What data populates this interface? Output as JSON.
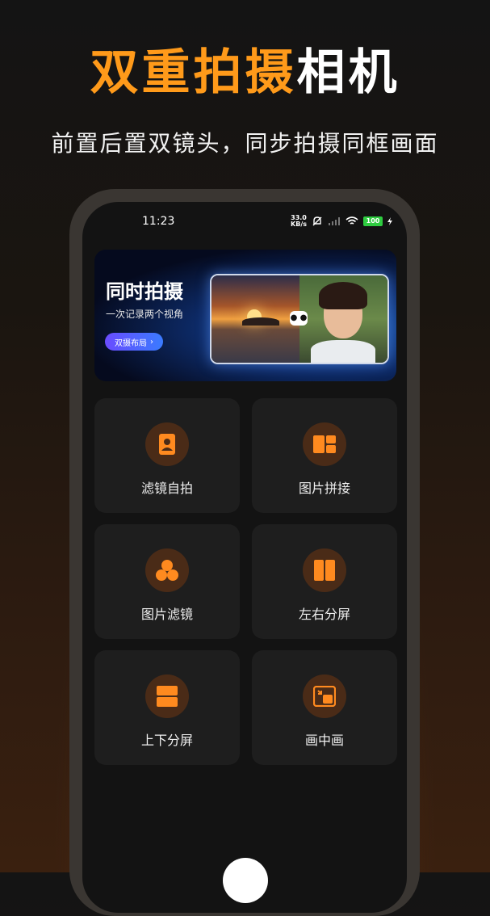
{
  "promo": {
    "title_accent": "双重拍摄",
    "title_rest": "相机",
    "subtitle": "前置后置双镜头，同步拍摄同框画面"
  },
  "status_bar": {
    "time": "11:23",
    "net_speed_value": "33.0",
    "net_speed_unit": "KB/s",
    "battery": "100"
  },
  "banner": {
    "title": "同时拍摄",
    "subtitle": "一次记录两个视角",
    "button_label": "双摄布局"
  },
  "features": [
    {
      "label": "滤镜自拍",
      "icon": "portrait-camera-icon"
    },
    {
      "label": "图片拼接",
      "icon": "collage-grid-icon"
    },
    {
      "label": "图片滤镜",
      "icon": "three-circles-icon"
    },
    {
      "label": "左右分屏",
      "icon": "split-vertical-icon"
    },
    {
      "label": "上下分屏",
      "icon": "split-horizontal-icon"
    },
    {
      "label": "画中画",
      "icon": "picture-in-picture-icon"
    }
  ],
  "colors": {
    "accent": "#ff9a1a",
    "icon_orange": "#ff8a1f",
    "tile_bg": "#1e1e1e",
    "screen_bg": "#131313"
  }
}
